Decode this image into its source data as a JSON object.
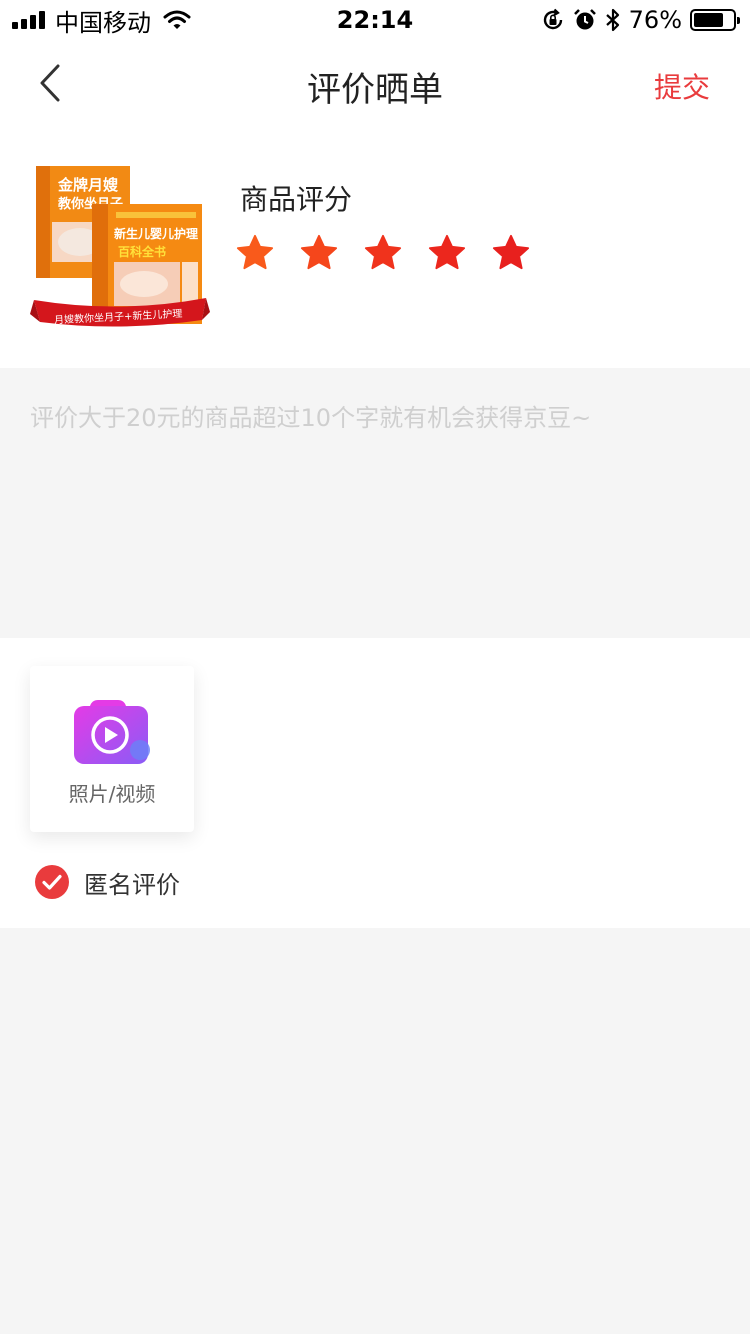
{
  "status_bar": {
    "carrier": "中国移动",
    "time": "22:14",
    "battery": "76%",
    "battery_level": 0.76,
    "icons": [
      "signal-icon",
      "wifi-icon",
      "orientation-lock-icon",
      "alarm-icon",
      "bluetooth-icon",
      "battery-icon"
    ]
  },
  "nav": {
    "back_icon": "chevron-left-icon",
    "title": "评价晒单",
    "submit": "提交"
  },
  "product": {
    "image_alt": "product-thumbnail",
    "cover_text_1": "金牌月嫂",
    "cover_text_2": "教你坐月子",
    "cover_text_3": "新生儿婴儿护理",
    "cover_text_4": "百科全书",
    "ribbon_text": "月嫂教你坐月子+新生儿护理",
    "rating_label": "商品评分",
    "rating": 5,
    "rating_max": 5
  },
  "comment": {
    "placeholder": "评价大于20元的商品超过10个字就有机会获得京豆~"
  },
  "media": {
    "upload_label": "照片/视频",
    "upload_icon": "camera-video-icon",
    "anonymous_label": "匿名评价",
    "anonymous_checked": true
  },
  "colors": {
    "accent": "#e93b3d",
    "star_colors": [
      "#f95a1b",
      "#f5461b",
      "#f0331c",
      "#ec271d",
      "#e8201e"
    ],
    "placeholder": "#cfcfcf",
    "page_bg": "#f5f5f5"
  }
}
